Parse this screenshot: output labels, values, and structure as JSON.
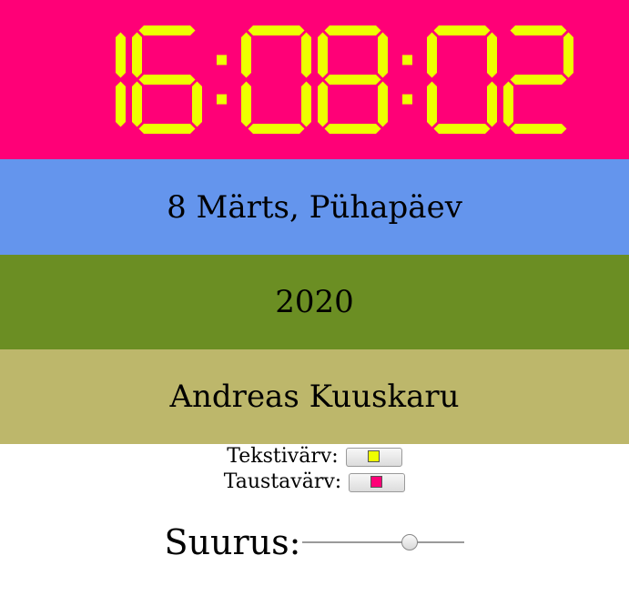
{
  "clock": {
    "time": "16:08:02",
    "text_color": "#EEFF00",
    "background_color": "#FF0077"
  },
  "date": {
    "text": "8 Märts, Pühapäev",
    "background_color": "#6495ED"
  },
  "year": {
    "text": "2020",
    "background_color": "#6B8E23"
  },
  "author": {
    "text": "Andreas Kuuskaru",
    "background_color": "#BDB76B"
  },
  "controls": {
    "text_color_label": "Tekstivärv:",
    "text_color_value": "#EEFF00",
    "background_color_label": "Taustavärv:",
    "background_color_value": "#FF0077",
    "size_label": "Suurus:",
    "size_value": 0.66
  }
}
